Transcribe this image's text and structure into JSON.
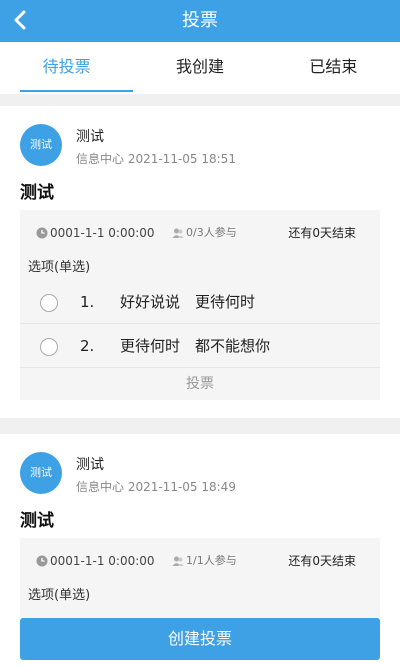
{
  "header": {
    "title": "投票"
  },
  "tabs": [
    {
      "label": "待投票"
    },
    {
      "label": "我创建"
    },
    {
      "label": "已结束"
    }
  ],
  "polls": [
    {
      "avatar_text": "测试",
      "author": "测试",
      "meta": "信息中心 2021-11-05 18:51",
      "title": "测试",
      "time": "0001-1-1 0:00:00",
      "participants": "0/3人参与",
      "remaining": "还有0天结束",
      "option_type": "选项(单选)",
      "options": [
        {
          "num": "1.",
          "text": "好好说说　更待何时"
        },
        {
          "num": "2.",
          "text": "更待何时　都不能想你"
        }
      ],
      "vote_label": "投票"
    },
    {
      "avatar_text": "测试",
      "author": "测试",
      "meta": "信息中心 2021-11-05 18:49",
      "title": "测试",
      "time": "0001-1-1 0:00:00",
      "participants": "1/1人参与",
      "remaining": "还有0天结束",
      "option_type": "选项(单选)"
    }
  ],
  "create_button": "创建投票",
  "colors": {
    "accent": "#3ea1e6"
  },
  "icons": {
    "back": "chevron-left-icon",
    "time": "clock-icon",
    "people": "people-icon"
  }
}
